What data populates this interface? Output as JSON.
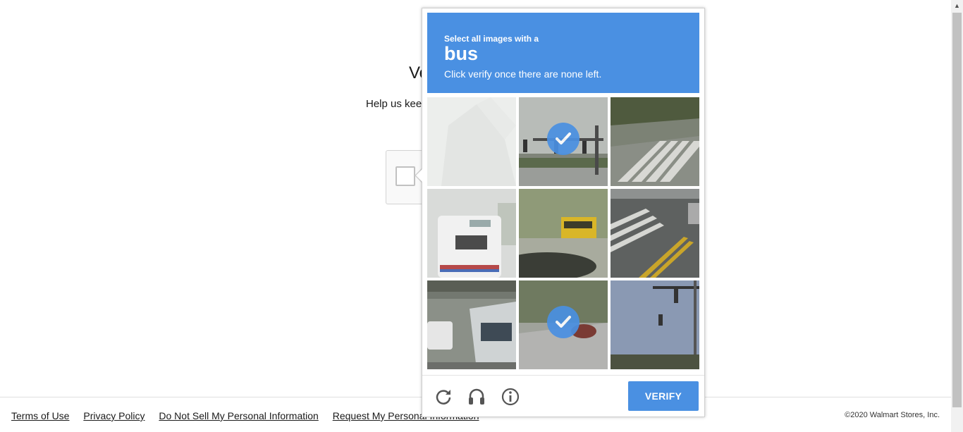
{
  "page": {
    "heading_partial": "Ve",
    "help_partial": "Help us kee"
  },
  "footer": {
    "links": [
      "Terms of Use",
      "Privacy Policy",
      "Do Not Sell My Personal Information",
      "Request My Personal Information"
    ],
    "copyright": "©2020 Walmart Stores, Inc."
  },
  "challenge": {
    "instruction_line1": "Select all images with a",
    "target": "bus",
    "instruction_line3": "Click verify once there are none left.",
    "tiles": [
      {
        "scene": "faded-building",
        "selected": false
      },
      {
        "scene": "traffic-light-intersection",
        "selected": true
      },
      {
        "scene": "crosswalk",
        "selected": false
      },
      {
        "scene": "bus-rear",
        "selected": false
      },
      {
        "scene": "school-bus-trees",
        "selected": false
      },
      {
        "scene": "crosswalk-yellow-lines",
        "selected": false
      },
      {
        "scene": "city-bus-underpass",
        "selected": false
      },
      {
        "scene": "road-car",
        "selected": true
      },
      {
        "scene": "traffic-light-sky",
        "selected": false
      }
    ],
    "verify_label": "VERIFY",
    "icons": [
      "reload-icon",
      "audio-icon",
      "info-icon"
    ]
  },
  "colors": {
    "accent": "#4a90e2"
  }
}
